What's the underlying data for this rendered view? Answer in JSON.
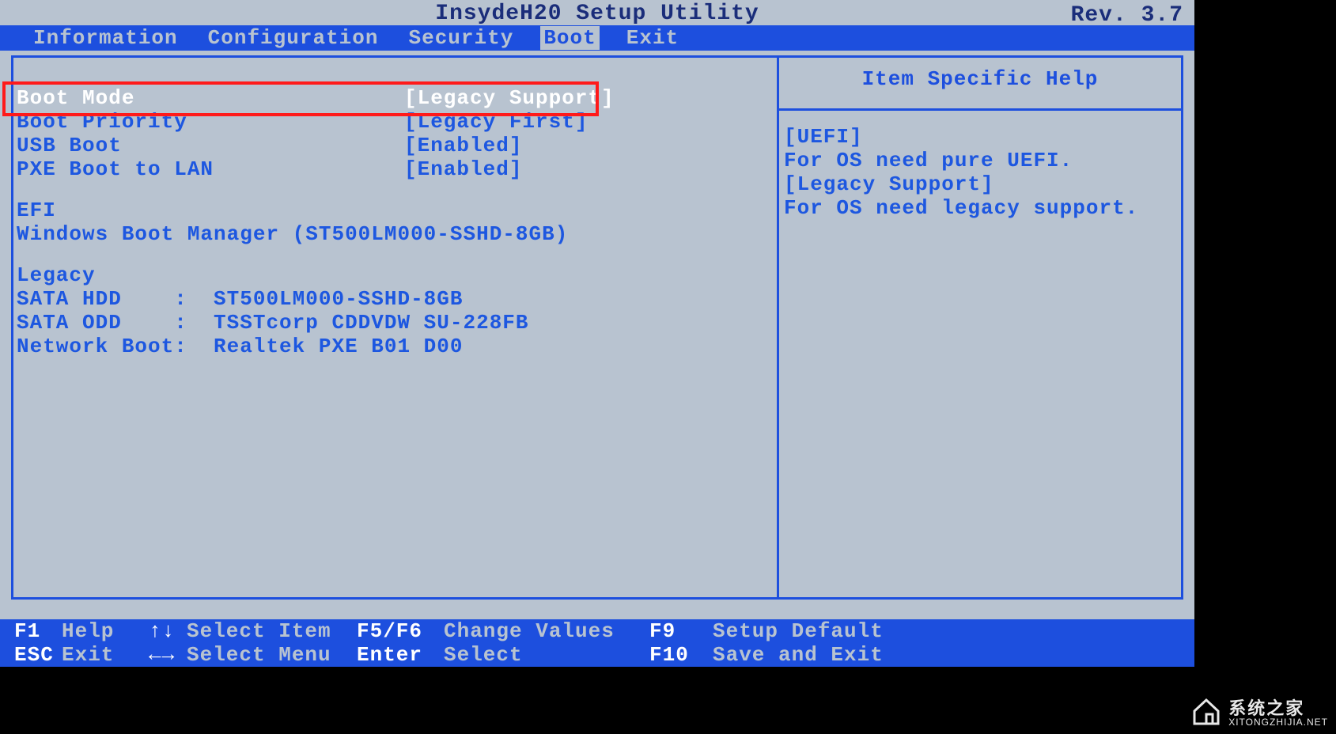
{
  "header": {
    "title": "InsydeH20 Setup Utility",
    "revision": "Rev. 3.7"
  },
  "tabs": [
    {
      "label": "Information",
      "active": false
    },
    {
      "label": "Configuration",
      "active": false
    },
    {
      "label": "Security",
      "active": false
    },
    {
      "label": "Boot",
      "active": true
    },
    {
      "label": "Exit",
      "active": false
    }
  ],
  "settings": [
    {
      "label": "Boot Mode",
      "value": "[Legacy Support]",
      "selected": true
    },
    {
      "label": "Boot Priority",
      "value": "[Legacy First]",
      "selected": false
    },
    {
      "label": "USB Boot",
      "value": "[Enabled]",
      "selected": false
    },
    {
      "label": "PXE Boot to LAN",
      "value": "[Enabled]",
      "selected": false
    }
  ],
  "efi": {
    "heading": "EFI",
    "items": [
      "Windows Boot Manager (ST500LM000-SSHD-8GB)"
    ]
  },
  "legacy": {
    "heading": "Legacy",
    "items": [
      "SATA HDD    :  ST500LM000-SSHD-8GB",
      "SATA ODD    :  TSSTcorp CDDVDW SU-228FB",
      "Network Boot:  Realtek PXE B01 D00"
    ]
  },
  "help": {
    "title": "Item Specific Help",
    "lines": [
      "[UEFI]",
      "For OS need pure UEFI.",
      "[Legacy Support]",
      "For OS need legacy support."
    ]
  },
  "footer": {
    "row1": [
      {
        "key": "F1",
        "arrow": "↑↓",
        "label1": "Help",
        "label2": "Select Item",
        "key2": "F5/F6",
        "label3": "Change Values",
        "key3": "F9",
        "label4": "Setup Default"
      }
    ],
    "row2": [
      {
        "key": "ESC",
        "arrow": "←→",
        "label1": "Exit",
        "label2": "Select Menu",
        "key2": "Enter",
        "label3": "Select",
        "key3": "F10",
        "label4": "Save and Exit"
      }
    ]
  },
  "watermark": {
    "text": "系统之家",
    "url": "XITONGZHIJIA.NET"
  }
}
